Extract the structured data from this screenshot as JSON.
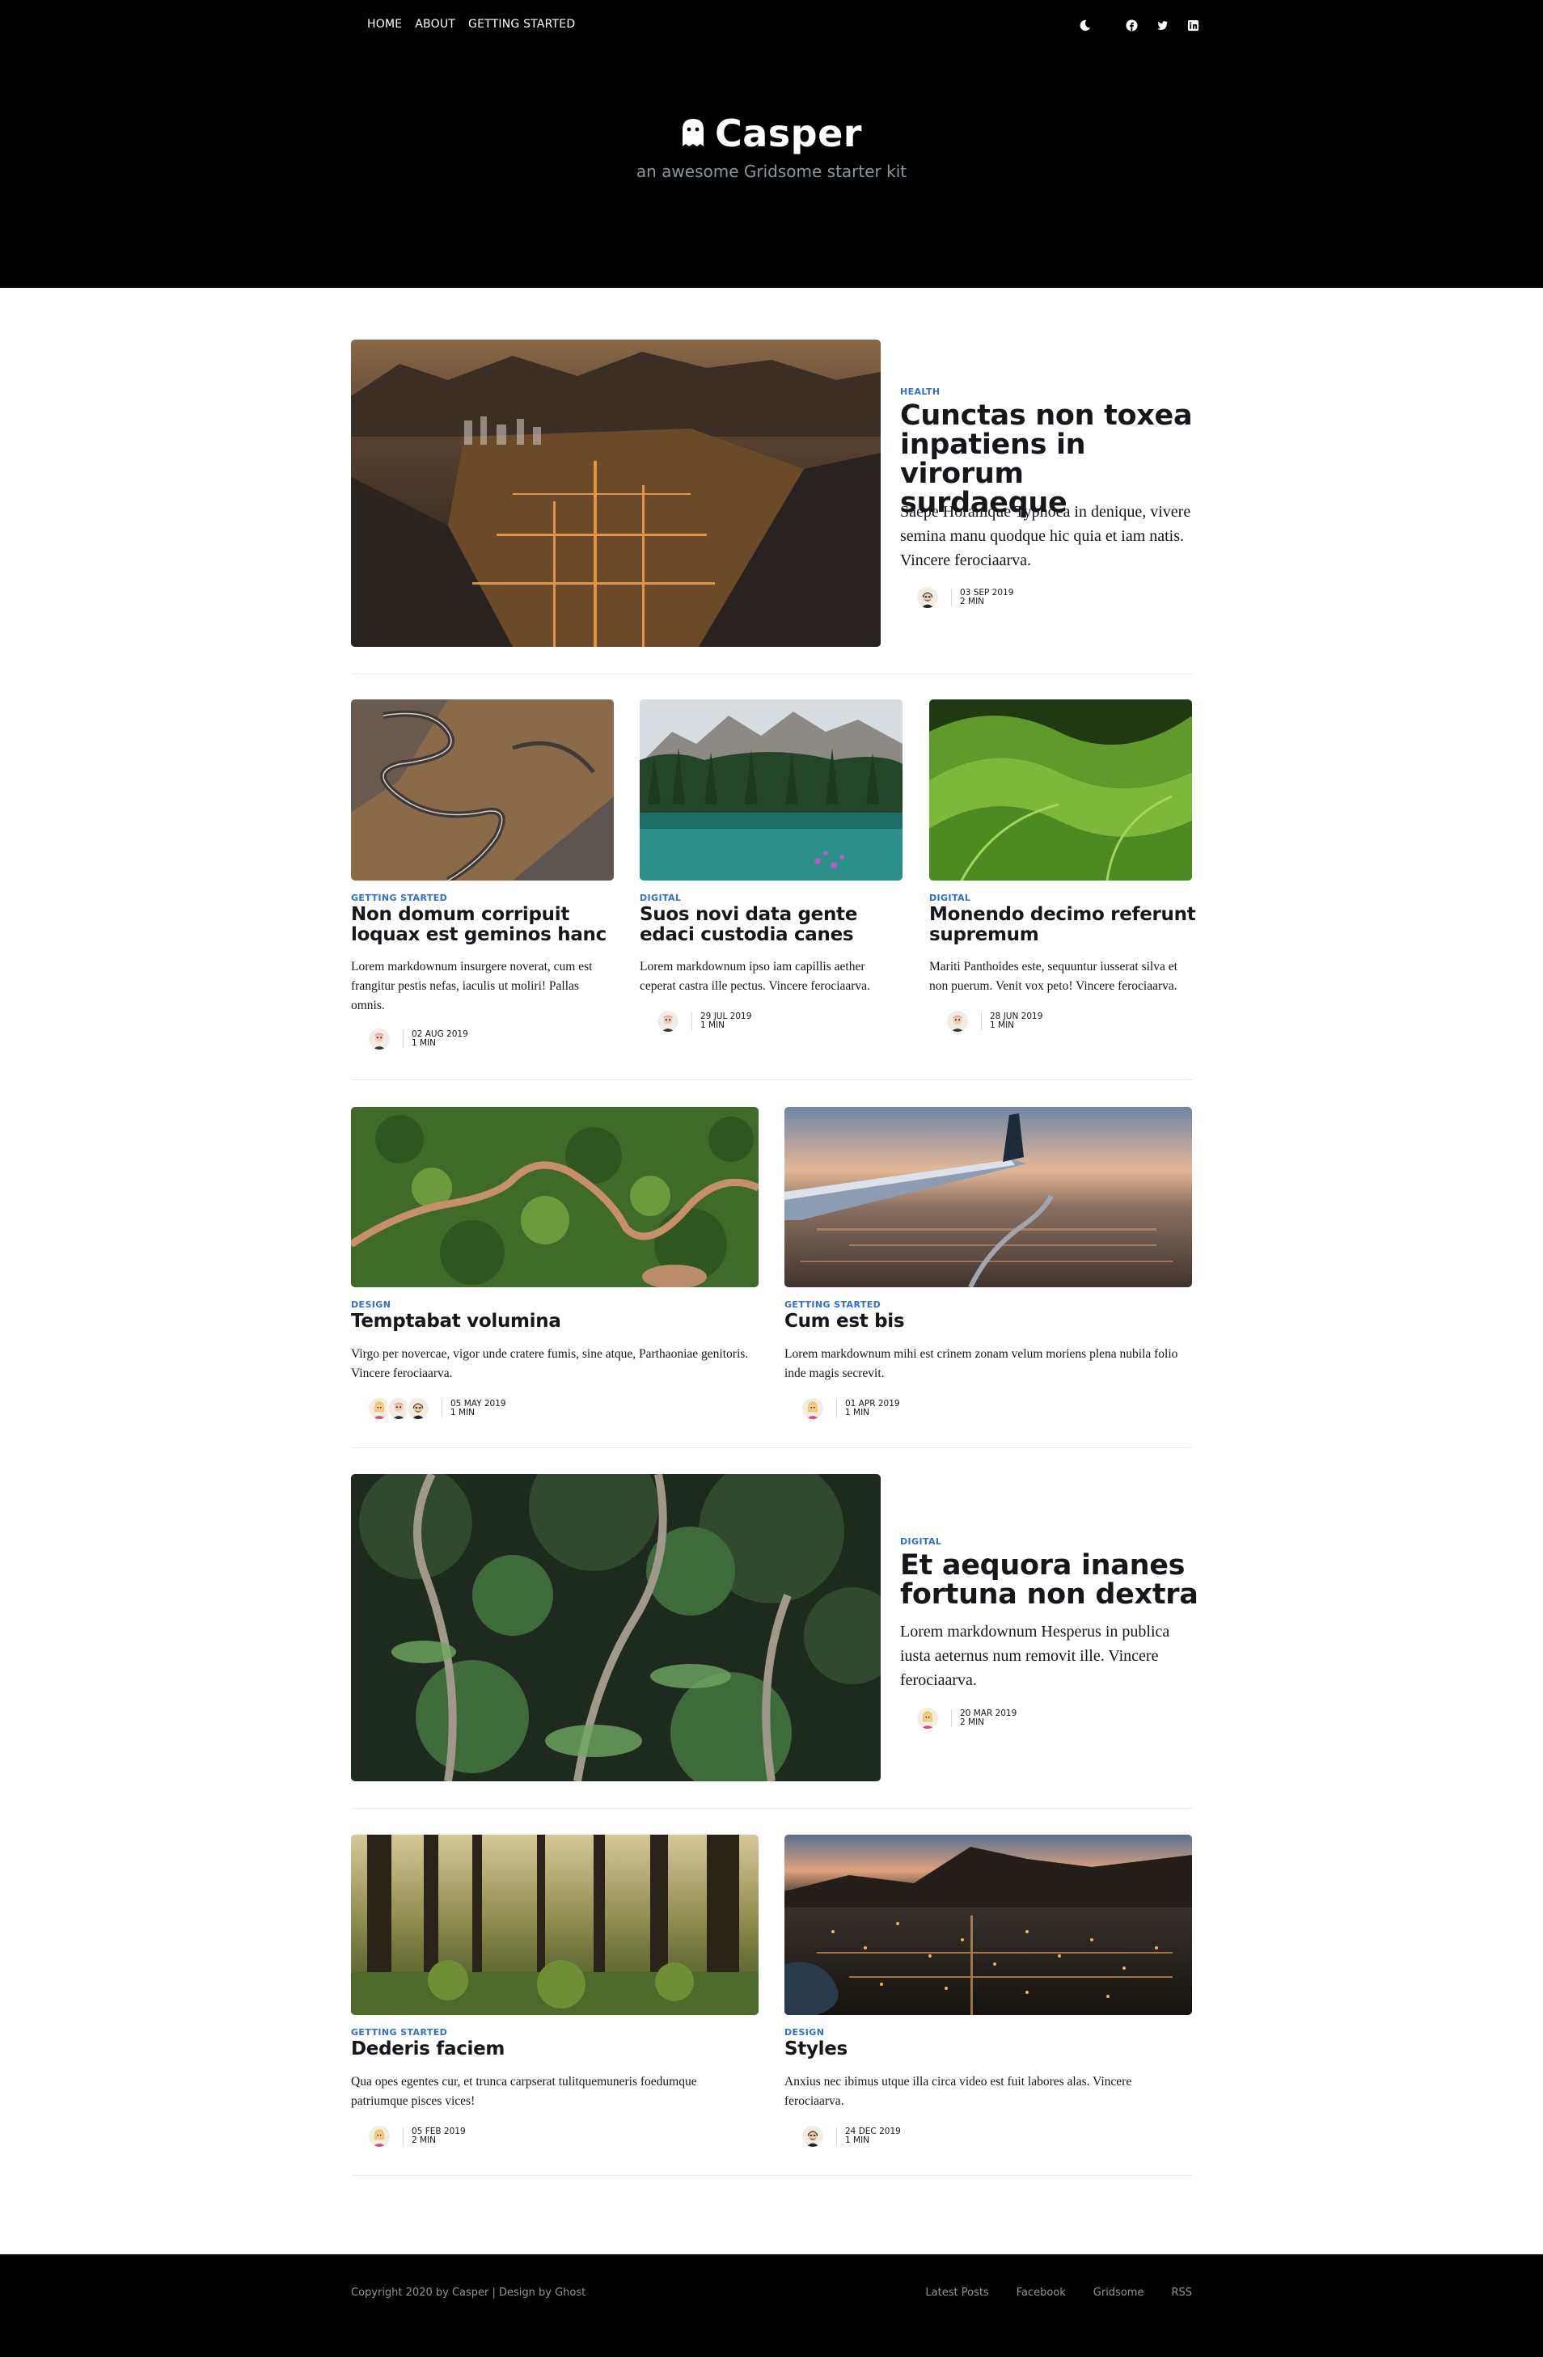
{
  "nav": {
    "links": [
      "HOME",
      "ABOUT",
      "GETTING STARTED"
    ],
    "icons": [
      "moon-icon",
      "facebook-icon",
      "twitter-icon",
      "linkedin-icon"
    ]
  },
  "site": {
    "title": "Casper",
    "description": "an awesome Gridsome starter kit"
  },
  "posts": [
    {
      "tag": "HEALTH",
      "title": "Cunctas non toxea inpatiens in virorum surdaeque",
      "excerpt": "Saepe Horamque Typhoea in denique, vivere semina manu quodque hic quia et iam natis. Vincere ferociaarva.",
      "date": "03 SEP 2019",
      "read": "2 MIN",
      "image": "city-valley-night"
    },
    {
      "tag": "GETTING STARTED",
      "title": "Non domum corripuit loquax est geminos hanc",
      "excerpt": "Lorem markdownum insurgere noverat, cum est frangitur pestis nefas, iaculis ut moliri! Pallas omnis.",
      "date": "02 AUG 2019",
      "read": "1 MIN",
      "image": "winding-road"
    },
    {
      "tag": "DIGITAL",
      "title": "Suos novi data gente edaci custodia canes",
      "excerpt": "Lorem markdownum ipso iam capillis aether ceperat castra ille pectus. Vincere ferociaarva.",
      "date": "29 JUL 2019",
      "read": "1 MIN",
      "image": "mountain-lake"
    },
    {
      "tag": "DIGITAL",
      "title": "Monendo decimo referunt supremum",
      "excerpt": "Mariti Panthoides este, sequuntur iusserat silva et non puerum. Venit vox peto! Vincere ferociaarva.",
      "date": "28 JUN 2019",
      "read": "1 MIN",
      "image": "green-hills"
    },
    {
      "tag": "DESIGN",
      "title": "Temptabat volumina",
      "excerpt": "Virgo per novercae, vigor unde cratere fumis, sine atque, Parthaoniae genitoris. Vincere ferociaarva.",
      "date": "05 MAY 2019",
      "read": "1 MIN",
      "image": "forest-road-aerial"
    },
    {
      "tag": "GETTING STARTED",
      "title": "Cum est bis",
      "excerpt": "Lorem markdownum mihi est crinem zonam velum moriens plena nubila folio inde magis secrevit.",
      "date": "01 APR 2019",
      "read": "1 MIN",
      "image": "airplane-wing"
    },
    {
      "tag": "DIGITAL",
      "title": "Et aequora inanes fortuna non dextra",
      "excerpt": "Lorem markdownum Hesperus in publica iusta aeternus num removit ille. Vincere ferociaarva.",
      "date": "20 MAR 2019",
      "read": "2 MIN",
      "image": "jungle"
    },
    {
      "tag": "GETTING STARTED",
      "title": "Dederis faciem",
      "excerpt": "Qua opes egentes cur, et trunca carpserat tulitquemuneris foedumque patriumque pisces vices!",
      "date": "05 FEB 2019",
      "read": "2 MIN",
      "image": "forest-sunlight"
    },
    {
      "tag": "DESIGN",
      "title": "Styles",
      "excerpt": "Anxius nec ibimus utque illa circa video est fuit labores alas. Vincere ferociaarva.",
      "date": "24 DEC 2019",
      "read": "1 MIN",
      "image": "city-lights-dusk"
    }
  ],
  "footer": {
    "copyright": "Copyright 2020 by Casper | Design by Ghost",
    "links": [
      "Latest Posts",
      "Facebook",
      "Gridsome",
      "RSS"
    ]
  },
  "colors": {
    "header_bg": "#000000",
    "tag": "#2f6fd1",
    "text": "#15171a",
    "muted": "#8d959c"
  }
}
